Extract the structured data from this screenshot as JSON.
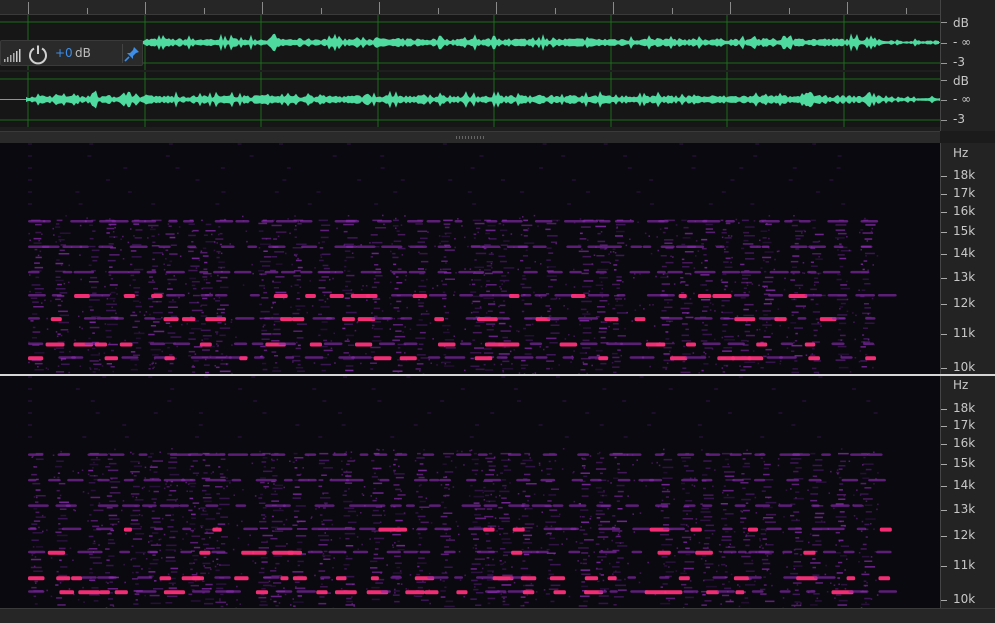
{
  "track": {
    "volume_value": "+0",
    "volume_unit": "dB",
    "icons": {
      "meter": "level-meter-icon",
      "power": "power-icon",
      "pin": "pin-icon"
    }
  },
  "amplitude_scale": {
    "top_channel": {
      "unit": "dB",
      "mid": "- ∞",
      "low": "-3"
    },
    "bottom_channel": {
      "unit": "dB",
      "mid": "- ∞",
      "low": "-3"
    }
  },
  "frequency_scale": {
    "top_channel": {
      "unit": "Hz",
      "labels": [
        "18k",
        "17k",
        "16k",
        "15k",
        "14k",
        "13k",
        "12k",
        "11k",
        "10k"
      ]
    },
    "bottom_channel": {
      "unit": "Hz",
      "labels": [
        "18k",
        "17k",
        "16k",
        "15k",
        "14k",
        "13k",
        "12k",
        "11k",
        "10k"
      ]
    }
  },
  "colors": {
    "waveform": "#4fdaa0",
    "spectrum_low": "#4a1a6a",
    "spectrum_mid": "#8a2ab0",
    "spectrum_high": "#ff2f7a",
    "accent_blue": "#3d8ee8"
  }
}
